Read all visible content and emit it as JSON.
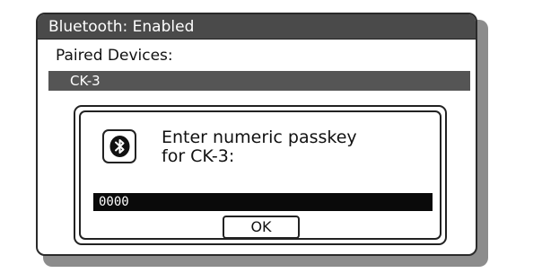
{
  "window": {
    "title": "Bluetooth: Enabled"
  },
  "paired": {
    "label": "Paired Devices:",
    "selected_device": "CK-3"
  },
  "dialog": {
    "icon": "bluetooth-icon",
    "prompt_line1": "Enter numeric passkey",
    "prompt_line2": "for CK-3:",
    "passkey_value": "0000",
    "ok_label": "OK"
  },
  "colors": {
    "title_bar": "#4a4a4a",
    "selected_row": "#555555",
    "passkey_field": "#0a0a0a",
    "shadow": "#8c8c8c"
  }
}
